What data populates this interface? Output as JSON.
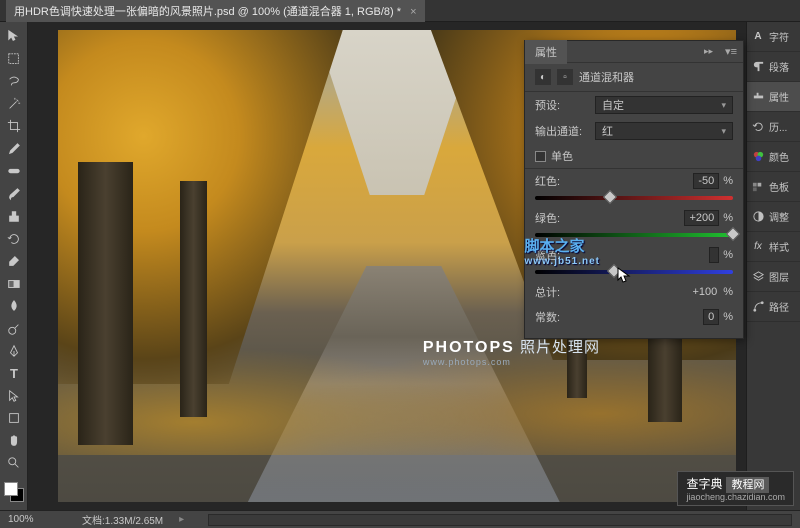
{
  "title_tab": "用HDR色调快速处理一张偏暗的风景照片.psd @ 100% (通道混合器 1, RGB/8) *",
  "panels": {
    "char": "字符",
    "para": "段落",
    "prop": "属性",
    "hist": "历...",
    "color": "颜色",
    "swatch": "色板",
    "adjust": "调整",
    "style": "样式",
    "layer": "图层",
    "path": "路径"
  },
  "properties": {
    "tab": "属性",
    "title": "通道混和器",
    "preset_label": "预设:",
    "preset_value": "自定",
    "output_label": "输出通道:",
    "output_value": "红",
    "mono": "单色",
    "red_label": "红色:",
    "red_value": "-50",
    "green_label": "绿色:",
    "green_value": "+200",
    "blue_label": "蓝色:",
    "blue_value": "",
    "total_label": "总计:",
    "total_value": "+100",
    "const_label": "常数:",
    "const_value": "0",
    "pct": "%"
  },
  "status": {
    "zoom": "100%",
    "doc": "文档:1.33M/2.65M"
  },
  "watermarks": {
    "w1": "脚本之家",
    "w1_sub": "www.jb51.net",
    "w2_brand": "PHOTOPS",
    "w2_cn": "照片处理网",
    "w2_sub": "www.photops.com",
    "w3": "查字典",
    "w3_sub": "教程网",
    "w3_url": "jiaocheng.chazidian.com"
  }
}
